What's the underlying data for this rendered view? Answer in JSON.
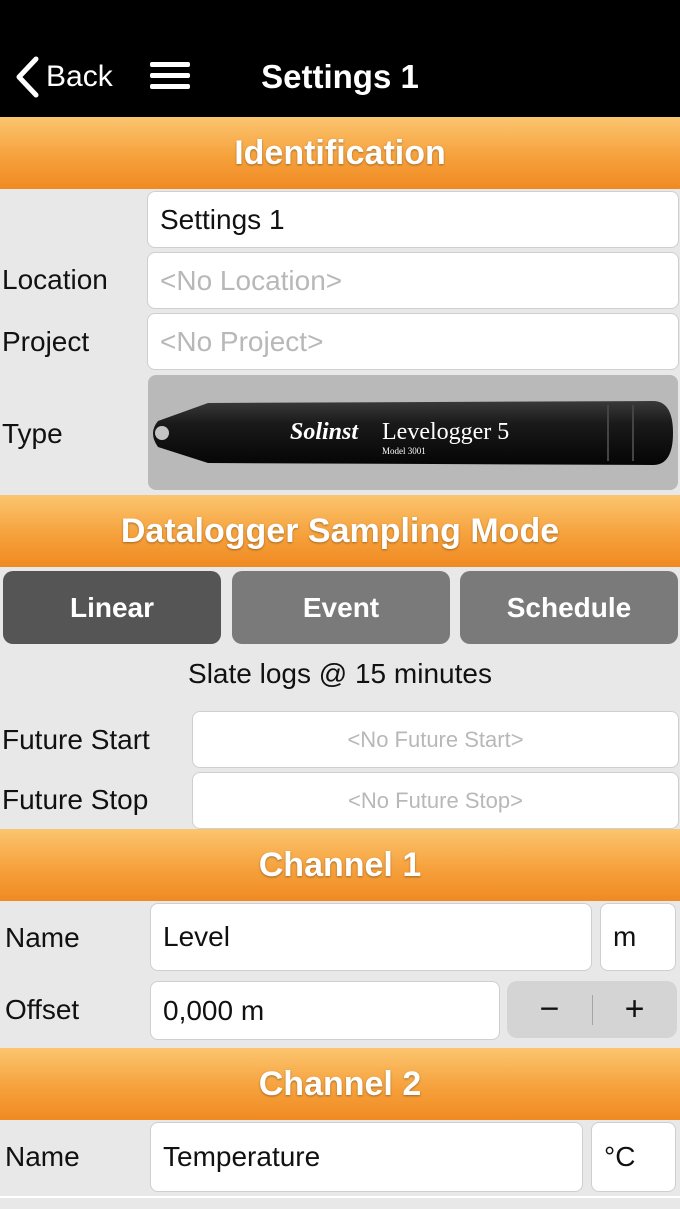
{
  "nav": {
    "back_label": "Back",
    "title": "Settings 1"
  },
  "identification": {
    "header": "Identification",
    "name_value": "Settings 1",
    "location_label": "Location",
    "location_placeholder": "<No Location>",
    "project_label": "Project",
    "project_placeholder": "<No Project>",
    "type_label": "Type",
    "device_brand": "Solinst",
    "device_model": "Levelogger 5",
    "device_model_number": "Model 3001"
  },
  "sampling": {
    "header": "Datalogger Sampling Mode",
    "modes": [
      "Linear",
      "Event",
      "Schedule"
    ],
    "selected_mode": "Linear",
    "status": "Slate logs @ 15 minutes",
    "future_start_label": "Future Start",
    "future_start_placeholder": "<No Future Start>",
    "future_stop_label": "Future Stop",
    "future_stop_placeholder": "<No Future Stop>"
  },
  "channel1": {
    "header": "Channel 1",
    "name_label": "Name",
    "name_value": "Level",
    "unit": "m",
    "offset_label": "Offset",
    "offset_value": "0,000 m",
    "minus": "−",
    "plus": "+"
  },
  "channel2": {
    "header": "Channel 2",
    "name_label": "Name",
    "name_value": "Temperature",
    "unit": "°C"
  },
  "colors": {
    "header_orange": "#f6a13c",
    "nav_black": "#000000",
    "button_active": "#555555",
    "button_inactive": "#7a7a7a"
  }
}
